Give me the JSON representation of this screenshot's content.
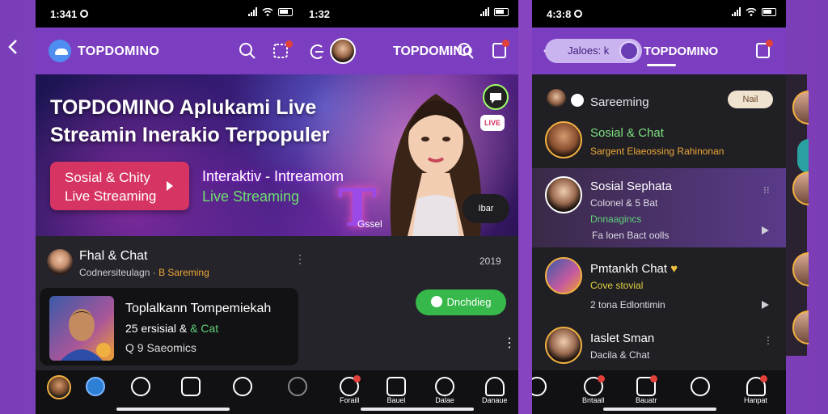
{
  "outer_back_icon": "chevron-left-icon",
  "left_phone": {
    "status_time": "1:341",
    "status_time_2": "1:32",
    "app_name": "TOPDOMINO",
    "app_name_2": "TOPDOMINO",
    "hero": {
      "title": "TOPDOMINO Aplukami Live Streamin Inerakio Terpopuler",
      "cta_line1": "Sosial & Chity",
      "cta_line2": "Live Streaming",
      "side_line1": "Interaktiv - Intreamom",
      "side_line2": "Live Streaming",
      "caption": "Gssel",
      "live_badge": "LIVE",
      "bar_badge": "Ibar"
    },
    "row1": {
      "title": "Fhal & Chat",
      "sub_prefix": "Codnersiteulagn",
      "sub_highlight": "B Sareming",
      "time": "2019"
    },
    "card": {
      "title": "Toplalkann Tompemiekah",
      "sub_prefix": "25 ersisial &",
      "sub_highlight": "& Cat",
      "meta": "Q 9 Saeomics"
    },
    "green_pill": "Dnchdieg",
    "nav_labels": [
      "",
      "",
      "",
      "",
      "",
      "",
      "Foraill",
      "Bauel",
      "Dalae",
      "Danaue"
    ]
  },
  "right_phone": {
    "status_time": "4:3:8",
    "tab_pill_label": "Jaloes: k",
    "app_name": "TOPDOMINO",
    "header": {
      "title": "Sareeming",
      "pill": "Nail"
    },
    "rows": [
      {
        "title": "Sosial & Chat",
        "sub": "Sargent Elaeossing  Rahinonan",
        "sub_color": "#f0a838",
        "sub2": ""
      },
      {
        "title": "Sosial Sephata",
        "sub": "Colonel & 5 Bat",
        "sub_color": "#dcdce4",
        "sub2_highlight": "Dnnaagincs",
        "sub2": "Fa loen Bact oolls"
      },
      {
        "title": "Pmtankh Chat",
        "sub": "Cove stovial",
        "sub_color": "#e0d040",
        "sub2": "2 tona Edlontimin"
      },
      {
        "title": "Iaslet Sman",
        "sub": "Dacila & Chat",
        "sub_color": "#dcdce4",
        "sub2": ""
      }
    ],
    "nav_labels": [
      "",
      "",
      "",
      "Bntaall",
      "Bauatr",
      "Hanpat"
    ]
  },
  "colors": {
    "brand_purple": "#7c3ec0",
    "cta_pink": "#d63462",
    "green": "#37b84a",
    "highlight_orange": "#f0a838"
  }
}
